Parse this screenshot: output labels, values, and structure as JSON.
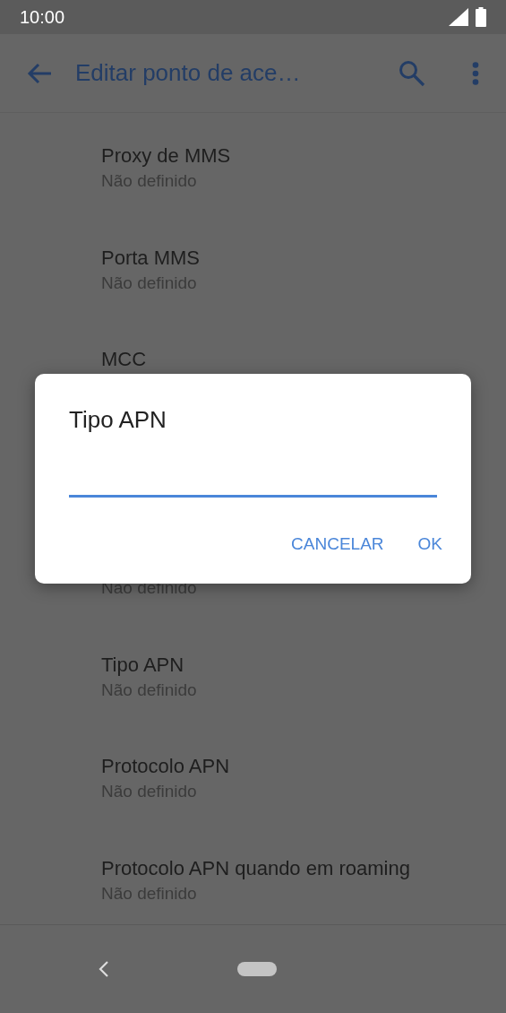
{
  "status_bar": {
    "time": "10:00"
  },
  "app_bar": {
    "title": "Editar ponto de ace…"
  },
  "settings": {
    "items_above_dialog": [
      {
        "title": "Proxy de MMS",
        "subtitle": "Não definido"
      },
      {
        "title": "Porta MMS",
        "subtitle": "Não definido"
      },
      {
        "title": "MCC"
      }
    ],
    "items_below_dialog": [
      {
        "subtitle": "Não definido"
      },
      {
        "title": "Tipo APN",
        "subtitle": "Não definido"
      },
      {
        "title": "Protocolo APN",
        "subtitle": "Não definido"
      },
      {
        "title": "Protocolo APN quando em roaming",
        "subtitle": "Não definido"
      }
    ]
  },
  "dialog": {
    "title": "Tipo APN",
    "input": {
      "focused": true
    },
    "buttons": [
      {
        "label": "CANCELAR"
      },
      {
        "label": "OK"
      }
    ]
  }
}
